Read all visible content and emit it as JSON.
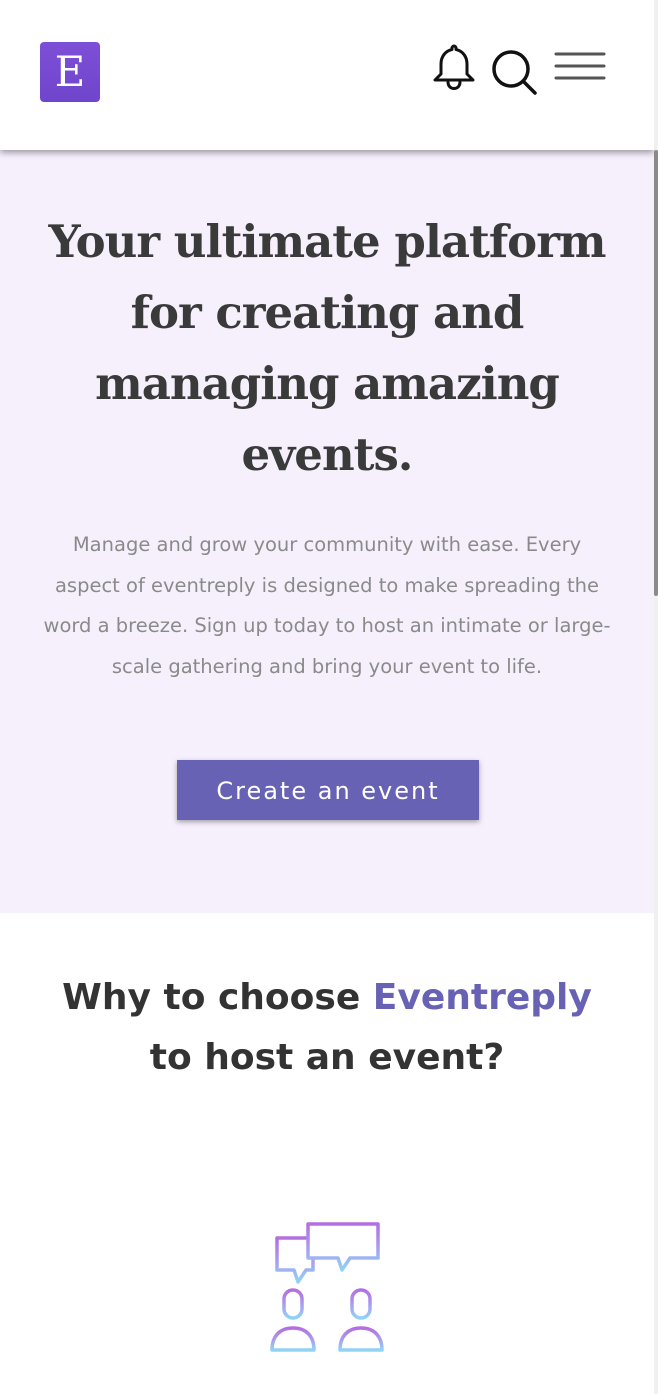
{
  "header": {
    "logo_letter": "E",
    "icons": [
      "bell-icon",
      "search-icon",
      "menu-icon"
    ]
  },
  "hero": {
    "title": "Your ultimate platform for creating and managing amazing events.",
    "description": "Manage and grow your community with ease. Every aspect of eventreply is designed to make spreading the word a breeze. Sign up today to host an intimate or large-scale gathering and bring your event to life.",
    "cta_label": "Create an event"
  },
  "why": {
    "title_prefix": "Why to choose",
    "title_brand": "Eventreply",
    "title_suffix": "to host an event?",
    "feature_icon": "community-chat-icon"
  },
  "colors": {
    "brand": "#6762b3",
    "logo": "#7a4dd4",
    "hero_bg": "#f6f0fd",
    "heading_text": "#3a3a3a",
    "body_text": "#8a8a8a"
  }
}
